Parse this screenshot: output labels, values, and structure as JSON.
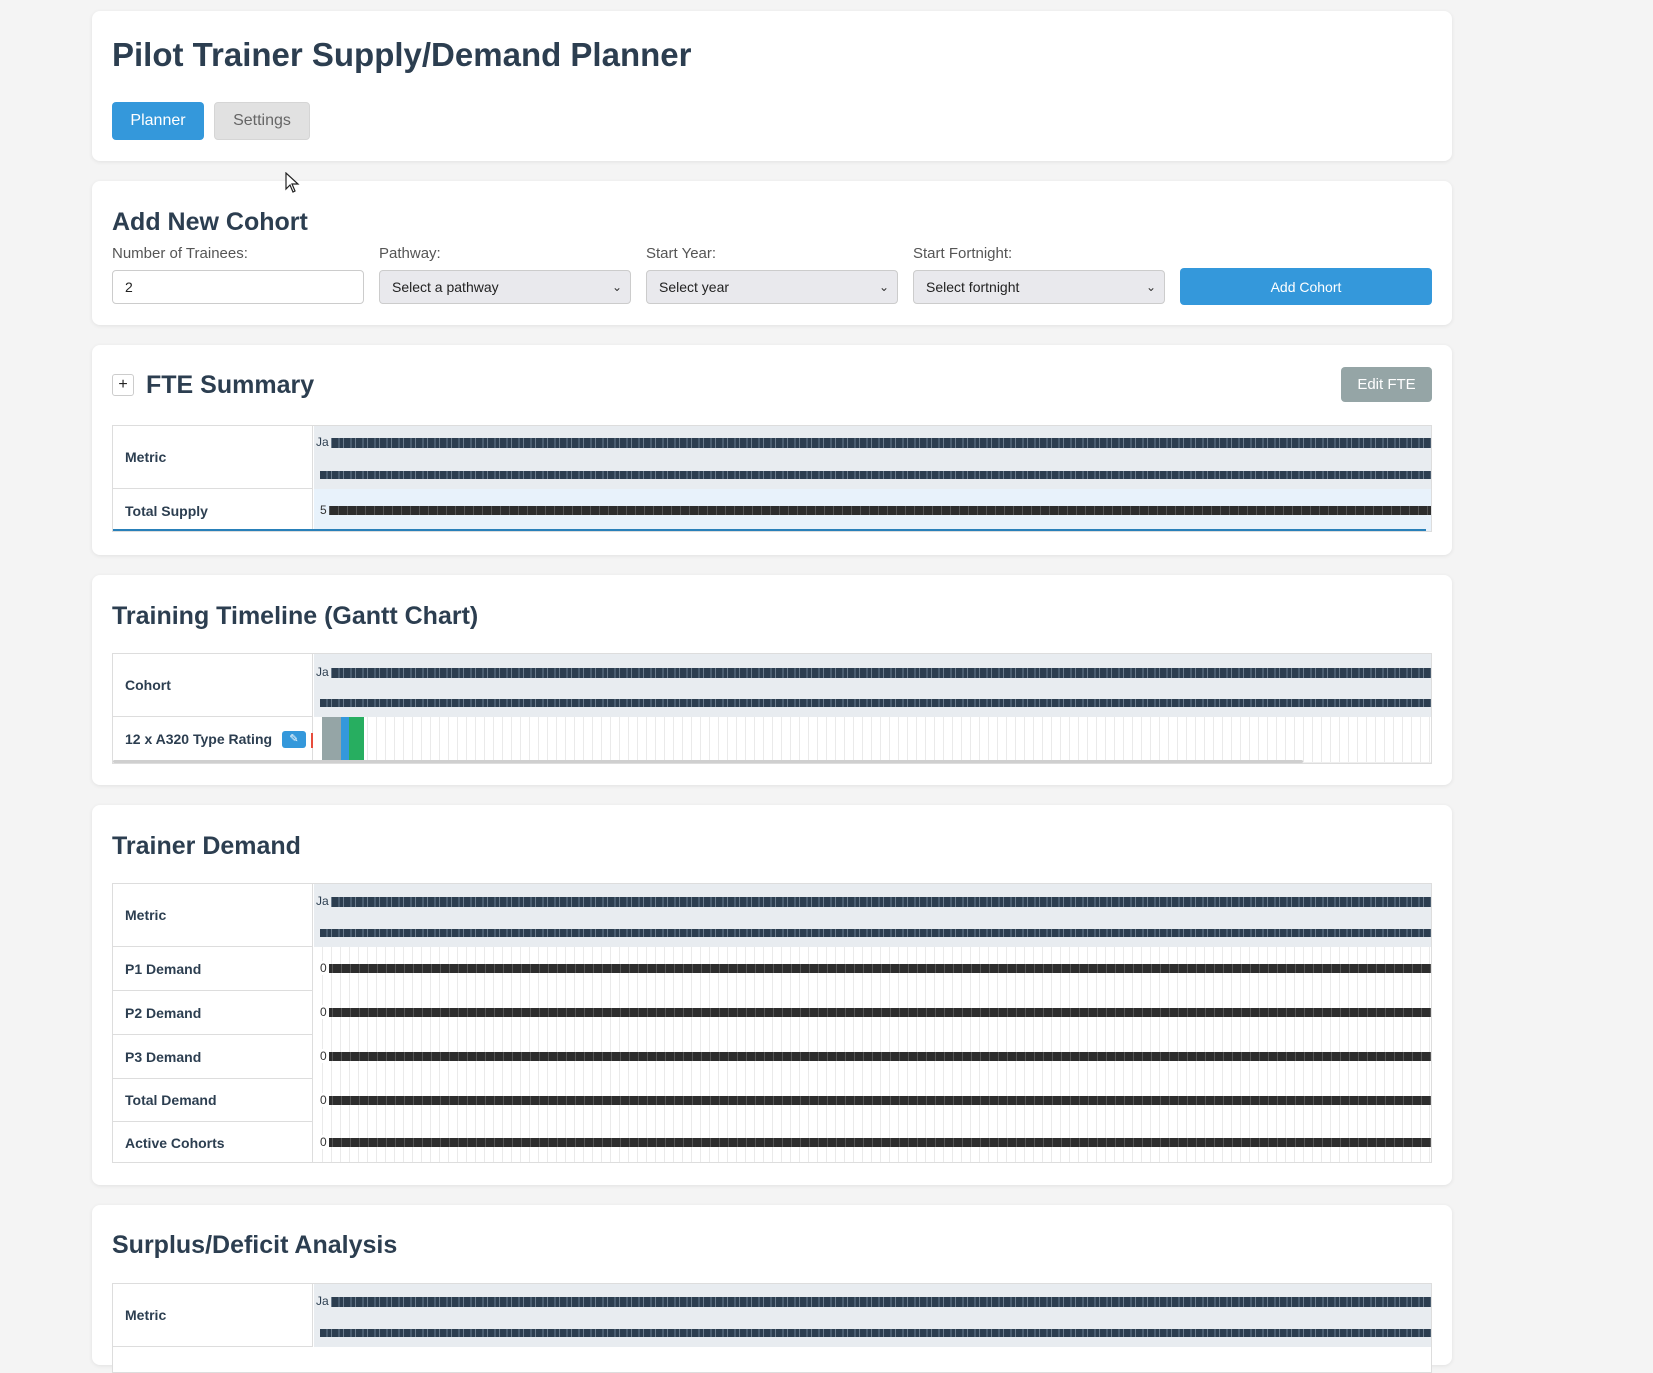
{
  "header": {
    "title": "Pilot Trainer Supply/Demand Planner",
    "tabs": [
      {
        "label": "Planner",
        "active": true
      },
      {
        "label": "Settings",
        "active": false
      }
    ]
  },
  "add_cohort": {
    "title": "Add New Cohort",
    "trainees_label": "Number of Trainees:",
    "trainees_value": "2",
    "pathway_label": "Pathway:",
    "pathway_value": "Select a pathway",
    "year_label": "Start Year:",
    "year_value": "Select year",
    "fortnight_label": "Start Fortnight:",
    "fortnight_value": "Select fortnight",
    "add_button": "Add Cohort"
  },
  "fte_summary": {
    "toggle": "+",
    "title": "FTE Summary",
    "edit_button": "Edit FTE",
    "metric_header": "Metric",
    "timeline_start": "Ja",
    "rows": [
      {
        "label": "Total Supply",
        "value_start": "5"
      }
    ]
  },
  "gantt": {
    "title": "Training Timeline (Gantt Chart)",
    "cohort_header": "Cohort",
    "timeline_start": "Ja",
    "cohorts": [
      {
        "label": "12 x A320 Type Rating",
        "edit_icon": "pencil-icon"
      }
    ]
  },
  "trainer_demand": {
    "title": "Trainer Demand",
    "metric_header": "Metric",
    "timeline_start": "Ja",
    "rows": [
      {
        "label": "P1 Demand",
        "value_start": "0"
      },
      {
        "label": "P2 Demand",
        "value_start": "0"
      },
      {
        "label": "P3 Demand",
        "value_start": "0"
      },
      {
        "label": "Total Demand",
        "value_start": "0"
      },
      {
        "label": "Active Cohorts",
        "value_start": "0"
      }
    ]
  },
  "surplus": {
    "title": "Surplus/Deficit Analysis",
    "metric_header": "Metric",
    "timeline_start": "Ja"
  },
  "colors": {
    "primary": "#3498db",
    "heading": "#2c3e50",
    "gray_button": "#95a5a6"
  }
}
